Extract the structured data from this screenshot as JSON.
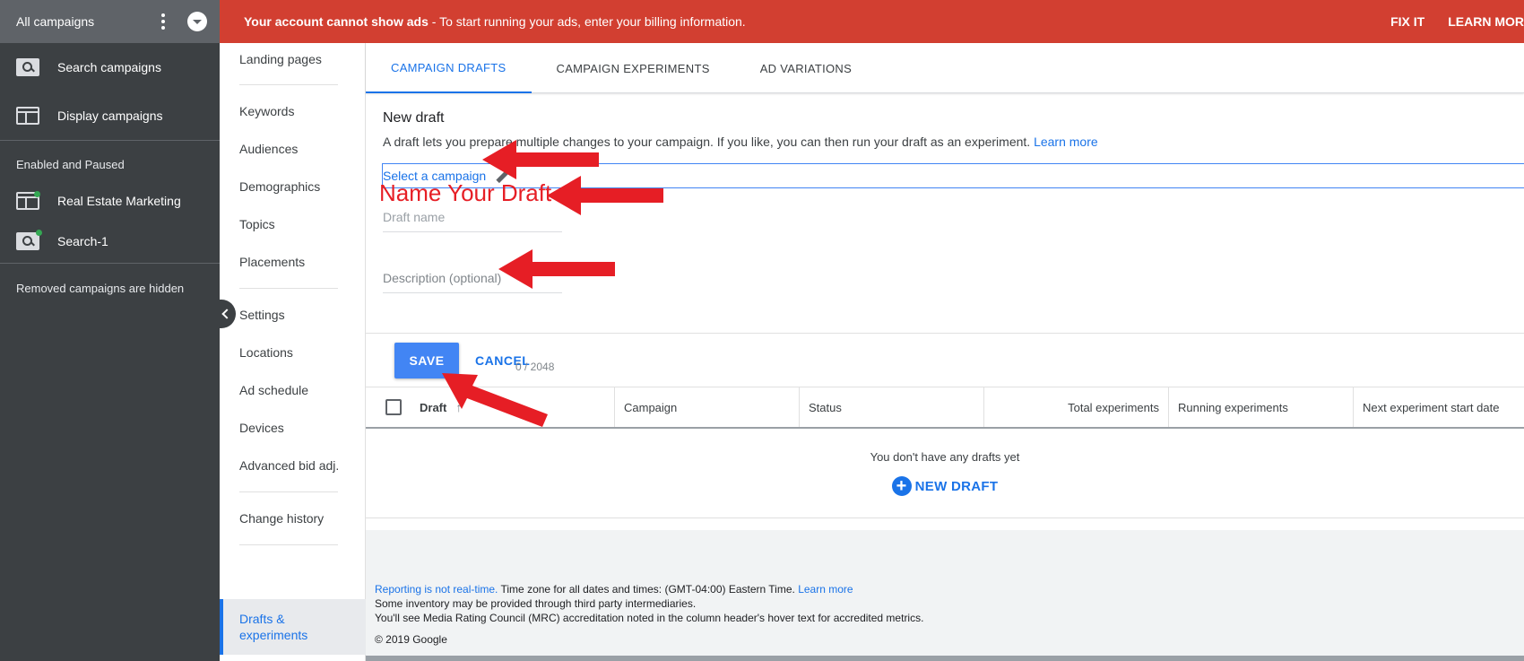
{
  "left_panel": {
    "title": "All campaigns",
    "items": [
      {
        "label": "Search campaigns",
        "icon": "search-campaign-icon"
      },
      {
        "label": "Display campaigns",
        "icon": "display-campaign-icon"
      }
    ],
    "group_label": "Enabled and Paused",
    "campaigns": [
      {
        "label": "Real Estate Marketing",
        "icon": "display-campaign-icon",
        "status_color": "#34a853"
      },
      {
        "label": "Search-1",
        "icon": "search-campaign-icon",
        "status_color": "#34a853"
      }
    ],
    "removed_note": "Removed campaigns are hidden"
  },
  "alert": {
    "bold": "Your account cannot show ads",
    "text": " - To start running your ads, enter your billing information.",
    "fix": "FIX IT",
    "learn": "LEARN MOR",
    "color": "#d23f31"
  },
  "nav": {
    "items": [
      "Landing pages",
      "Keywords",
      "Audiences",
      "Demographics",
      "Topics",
      "Placements",
      "Settings",
      "Locations",
      "Ad schedule",
      "Devices",
      "Advanced bid adj.",
      "Change history"
    ],
    "active_line1": "Drafts &",
    "active_line2": "experiments"
  },
  "tabs": [
    "CAMPAIGN DRAFTS",
    "CAMPAIGN EXPERIMENTS",
    "AD VARIATIONS"
  ],
  "draft_form": {
    "title": "New draft",
    "description": "A draft lets you prepare multiple changes to your campaign. If you like, you can then run your draft as an experiment.",
    "learn_more": "Learn more",
    "select_campaign": "Select a campaign",
    "draft_name_placeholder": "Draft name",
    "description_placeholder": "Description (optional)",
    "counter": "0 / 2048",
    "annotation": "Name Your Draft"
  },
  "actions": {
    "save": "SAVE",
    "cancel": "CANCEL"
  },
  "table": {
    "columns": [
      "Draft",
      "Campaign",
      "Status",
      "Total experiments",
      "Running experiments",
      "Next experiment start date"
    ],
    "empty": "You don't have any drafts yet",
    "new_draft": "NEW DRAFT"
  },
  "footer": {
    "reporting": "Reporting is not real-time.",
    "timezone": " Time zone for all dates and times: (GMT-04:00) Eastern Time. ",
    "learn_more": "Learn more",
    "line2": "Some inventory may be provided through third party intermediaries.",
    "line3": "You'll see Media Rating Council (MRC) accreditation noted in the column header's hover text for accredited metrics.",
    "copyright": "© 2019 Google"
  },
  "colors": {
    "accent": "#1a73e8",
    "save_button": "#4285f4",
    "annotation": "#e61e25"
  }
}
